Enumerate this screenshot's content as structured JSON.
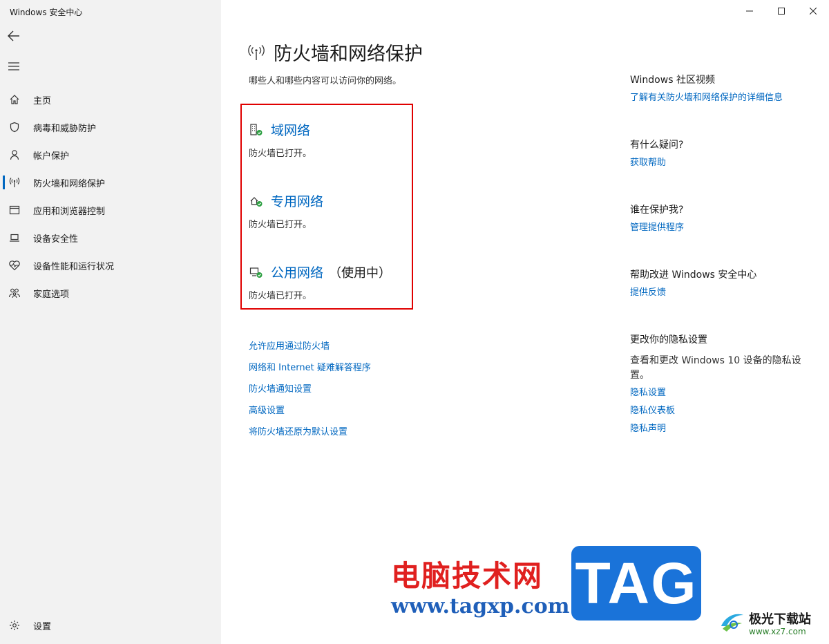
{
  "window": {
    "title": "Windows 安全中心"
  },
  "sidebar": {
    "items": [
      {
        "label": "主页",
        "icon": "home-icon"
      },
      {
        "label": "病毒和威胁防护",
        "icon": "shield-icon"
      },
      {
        "label": "帐户保护",
        "icon": "person-icon"
      },
      {
        "label": "防火墙和网络保护",
        "icon": "wifi-signal-icon",
        "active": true
      },
      {
        "label": "应用和浏览器控制",
        "icon": "browser-window-icon"
      },
      {
        "label": "设备安全性",
        "icon": "laptop-icon"
      },
      {
        "label": "设备性能和运行状况",
        "icon": "heart-pulse-icon"
      },
      {
        "label": "家庭选项",
        "icon": "family-icon"
      }
    ],
    "settings_label": "设置"
  },
  "main": {
    "title": "防火墙和网络保护",
    "subtitle": "哪些人和哪些内容可以访问你的网络。",
    "networks": [
      {
        "name": "域网络",
        "tag": "",
        "status": "防火墙已打开。",
        "icon": "domain-network-icon"
      },
      {
        "name": "专用网络",
        "tag": "",
        "status": "防火墙已打开。",
        "icon": "private-network-icon"
      },
      {
        "name": "公用网络",
        "tag": "（使用中）",
        "status": "防火墙已打开。",
        "icon": "public-network-icon"
      }
    ],
    "links": [
      "允许应用通过防火墙",
      "网络和 Internet 疑难解答程序",
      "防火墙通知设置",
      "高级设置",
      "将防火墙还原为默认设置"
    ]
  },
  "right": {
    "sections": [
      {
        "heading": "Windows 社区视频",
        "links": [
          "了解有关防火墙和网络保护的详细信息"
        ]
      },
      {
        "heading": "有什么疑问?",
        "links": [
          "获取帮助"
        ]
      },
      {
        "heading": "谁在保护我?",
        "links": [
          "管理提供程序"
        ]
      },
      {
        "heading": "帮助改进 Windows 安全中心",
        "links": [
          "提供反馈"
        ]
      },
      {
        "heading": "更改你的隐私设置",
        "text": "查看和更改 Windows 10 设备的隐私设置。",
        "links": [
          "隐私设置",
          "隐私仪表板",
          "隐私声明"
        ]
      }
    ]
  },
  "watermark": {
    "cn": "电脑技术网",
    "url": "www.tagxp.com",
    "tag": "TAG",
    "brand": "极光下载站",
    "brand_url": "www.xz7.com"
  },
  "colors": {
    "accent": "#0067c0",
    "highlight": "#e00000",
    "status_ok": "#2ea043"
  }
}
